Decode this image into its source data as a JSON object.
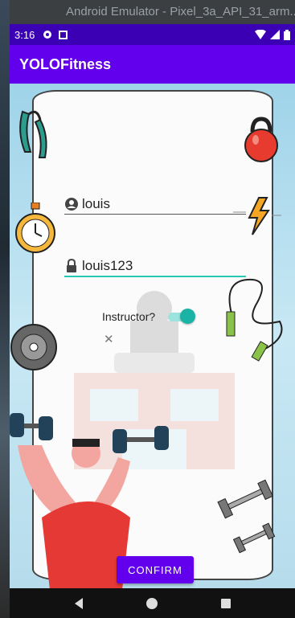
{
  "window": {
    "title": "Android Emulator - Pixel_3a_API_31_arm..."
  },
  "status_bar": {
    "time": "3:16",
    "icons": [
      "media-icon",
      "notification-icon"
    ],
    "right_icons": [
      "wifi-icon",
      "signal-icon",
      "battery-icon"
    ]
  },
  "app_bar": {
    "title": "YOLOFitness"
  },
  "form": {
    "username": {
      "value": "louis",
      "icon": "user-icon"
    },
    "password": {
      "value": "louis123",
      "icon": "lock-icon"
    },
    "instructor": {
      "label": "Instructor?",
      "checked": true
    }
  },
  "confirm_button": {
    "label": "CONFIRM"
  },
  "nav_bar": {
    "buttons": [
      "back-icon",
      "home-icon",
      "recents-icon"
    ]
  },
  "colors": {
    "primary": "#6200ee",
    "status_bar": "#3b00b3",
    "accent": "#1ab3a6"
  }
}
